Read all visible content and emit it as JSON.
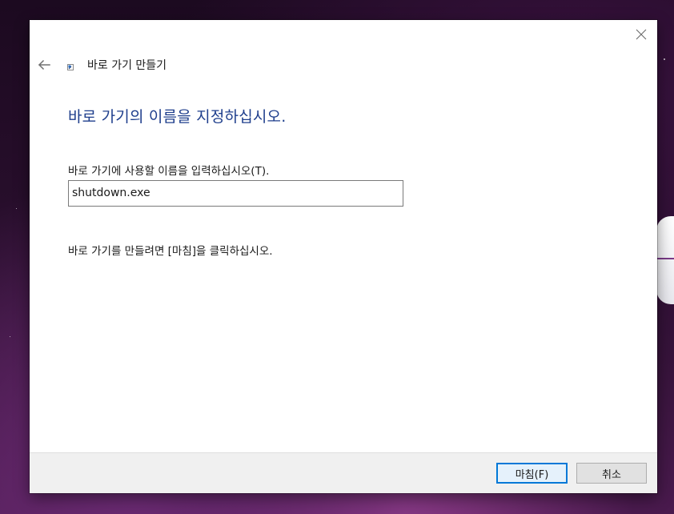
{
  "dialog": {
    "title": "바로 가기 만들기",
    "main_instruction": "바로 가기의 이름을 지정하십시오.",
    "field_label": "바로 가기에 사용할 이름을 입력하십시오(T).",
    "name_value": "shutdown.exe",
    "finish_instruction": "바로 가기를 만들려면 [마침]을 클릭하십시오."
  },
  "buttons": {
    "finish_label": "마침(F)",
    "cancel_label": "취소"
  },
  "icons": {
    "back": "back-arrow-icon",
    "close": "close-icon",
    "wizard": "shortcut-icon"
  },
  "colors": {
    "instruction_blue": "#1e3e8c",
    "default_button_border": "#0078d7"
  }
}
